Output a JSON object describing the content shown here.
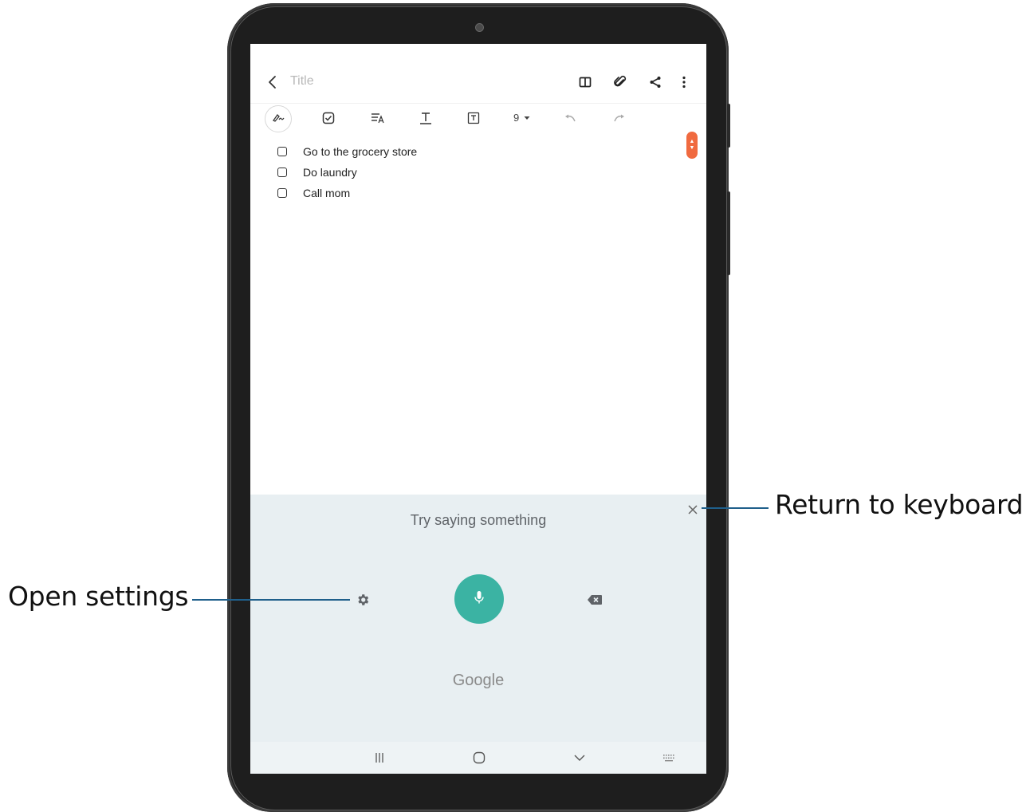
{
  "note": {
    "title_placeholder": "Title",
    "font_size": "9",
    "items": [
      {
        "label": "Go to the grocery store",
        "checked": false
      },
      {
        "label": "Do laundry",
        "checked": false
      },
      {
        "label": "Call mom",
        "checked": false
      }
    ]
  },
  "appbar_icons": [
    "back-icon",
    "reading-mode-icon",
    "attach-icon",
    "share-icon",
    "more-icon"
  ],
  "toolbar_icons": [
    "pen-icon",
    "checkbox-icon",
    "text-style-icon",
    "text-format-icon",
    "text-box-icon",
    "dropdown-icon",
    "undo-icon",
    "redo-icon"
  ],
  "voice_input": {
    "prompt": "Try saying something",
    "brand": "Google",
    "accent_color": "#3bb3a3",
    "icons": [
      "close-icon",
      "settings-icon",
      "mic-icon",
      "backspace-icon"
    ]
  },
  "navbar_icons": [
    "recent-apps-icon",
    "home-icon",
    "hide-keyboard-icon",
    "keyboard-icon"
  ],
  "callouts": {
    "return_to_keyboard": "Return to keyboard",
    "open_settings": "Open settings"
  },
  "scroll_handle_color": "#f06a3f"
}
